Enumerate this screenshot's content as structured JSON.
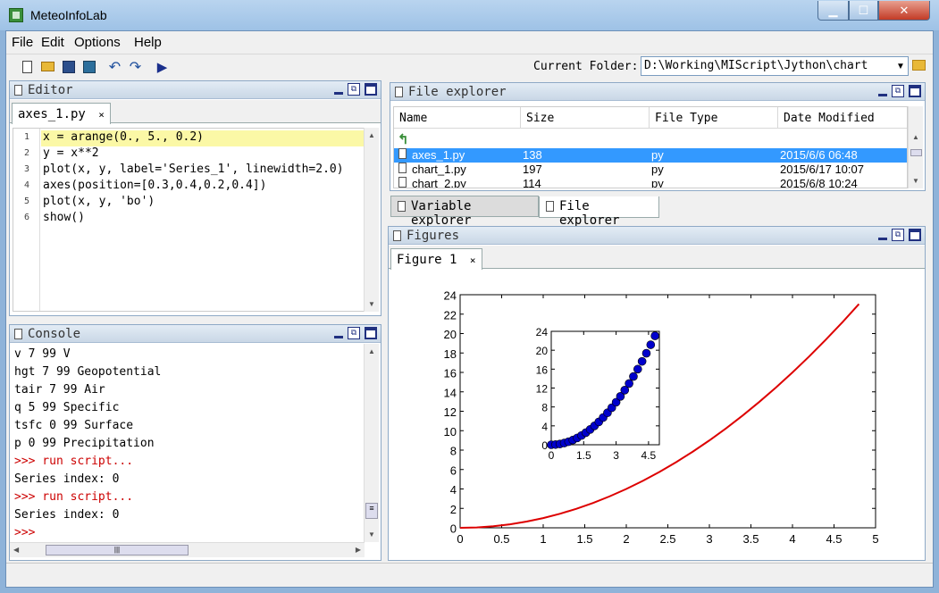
{
  "window": {
    "title": "MeteoInfoLab"
  },
  "menu": [
    "File",
    "Edit",
    "Options",
    "Help"
  ],
  "toolbar": {
    "icons": [
      "new-file-icon",
      "open-folder-icon",
      "save-icon",
      "save-all-icon",
      "undo-icon",
      "redo-icon",
      "run-icon"
    ]
  },
  "folder": {
    "label": "Current Folder:",
    "value": "D:\\Working\\MIScript\\Jython\\chart"
  },
  "editor": {
    "title": "Editor",
    "tab": "axes_1.py",
    "tab_close": "×",
    "line_numbers": [
      "1",
      "2",
      "3",
      "4",
      "5",
      "6"
    ],
    "lines": [
      "x = arange(0., 5., 0.2)",
      "y = x**2",
      "plot(x, y, label='Series_1', linewidth=2.0)",
      "axes(position=[0.3,0.4,0.2,0.4])",
      "plot(x, y, 'bo')",
      "show()"
    ]
  },
  "console": {
    "title": "Console",
    "lines": [
      {
        "text": "v 7 99 V",
        "color": "#000000"
      },
      {
        "text": "hgt 7 99 Geopotential",
        "color": "#000000"
      },
      {
        "text": "tair 7 99 Air",
        "color": "#000000"
      },
      {
        "text": "q 5 99 Specific",
        "color": "#000000"
      },
      {
        "text": "tsfc 0 99 Surface",
        "color": "#000000"
      },
      {
        "text": "p 0 99 Precipitation",
        "color": "#000000"
      },
      {
        "text": ">>> run script...",
        "color": "#cc0000"
      },
      {
        "text": "Series index: 0",
        "color": "#000000"
      },
      {
        "text": ">>> run script...",
        "color": "#cc0000"
      },
      {
        "text": "Series index: 0",
        "color": "#000000"
      },
      {
        "text": ">>>",
        "color": "#cc0000"
      }
    ]
  },
  "file_explorer": {
    "title": "File explorer",
    "columns": [
      "Name",
      "Size",
      "File Type",
      "Date Modified"
    ],
    "rows": [
      {
        "name": "axes_1.py",
        "size": "138",
        "type": "py",
        "date": "2015/6/6 06:48",
        "selected": true
      },
      {
        "name": "chart_1.py",
        "size": "197",
        "type": "py",
        "date": "2015/6/17 10:07",
        "selected": false
      },
      {
        "name": "chart_2.py",
        "size": "114",
        "type": "py",
        "date": "2015/6/8 10:24",
        "selected": false
      }
    ],
    "bottom_tabs": [
      "Variable explorer",
      "File explorer"
    ]
  },
  "figures": {
    "title": "Figures",
    "tab": "Figure 1",
    "tab_close": "×"
  },
  "chart_data": [
    {
      "type": "line",
      "title": "",
      "series": [
        {
          "color": "#dd0000",
          "x": [
            0,
            0.2,
            0.4,
            0.6,
            0.8,
            1.0,
            1.2,
            1.4,
            1.6,
            1.8,
            2.0,
            2.2,
            2.4,
            2.6,
            2.8,
            3.0,
            3.2,
            3.4,
            3.6,
            3.8,
            4.0,
            4.2,
            4.4,
            4.6,
            4.8
          ],
          "y": [
            0,
            0.04,
            0.16,
            0.36,
            0.64,
            1.0,
            1.44,
            1.96,
            2.56,
            3.24,
            4.0,
            4.84,
            5.76,
            6.76,
            7.84,
            9.0,
            10.24,
            11.56,
            12.96,
            14.44,
            16.0,
            17.64,
            19.36,
            21.16,
            23.04
          ]
        }
      ],
      "xlim": [
        0,
        5
      ],
      "ylim": [
        0,
        24
      ],
      "xticks": [
        "0",
        "0.5",
        "1",
        "1.5",
        "2",
        "2.5",
        "3",
        "3.5",
        "4",
        "4.5",
        "5"
      ],
      "yticks": [
        "0",
        "2",
        "4",
        "6",
        "8",
        "10",
        "12",
        "14",
        "16",
        "18",
        "20",
        "22",
        "24"
      ]
    },
    {
      "type": "scatter",
      "title": "",
      "series": [
        {
          "color": "#0000cc",
          "marker": "o",
          "x": [
            0,
            0.2,
            0.4,
            0.6,
            0.8,
            1.0,
            1.2,
            1.4,
            1.6,
            1.8,
            2.0,
            2.2,
            2.4,
            2.6,
            2.8,
            3.0,
            3.2,
            3.4,
            3.6,
            3.8,
            4.0,
            4.2,
            4.4,
            4.6,
            4.8
          ],
          "y": [
            0,
            0.04,
            0.16,
            0.36,
            0.64,
            1.0,
            1.44,
            1.96,
            2.56,
            3.24,
            4.0,
            4.84,
            5.76,
            6.76,
            7.84,
            9.0,
            10.24,
            11.56,
            12.96,
            14.44,
            16.0,
            17.64,
            19.36,
            21.16,
            23.04
          ]
        }
      ],
      "xlim": [
        0,
        5
      ],
      "ylim": [
        0,
        24
      ],
      "xticks": [
        "0",
        "1.5",
        "3",
        "4.5"
      ],
      "yticks": [
        "0",
        "4",
        "8",
        "12",
        "16",
        "20",
        "24"
      ]
    }
  ]
}
